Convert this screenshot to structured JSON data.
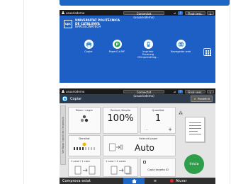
{
  "home": {
    "status_bar": {
      "user": "usuarioderno",
      "connection": "Connectat (usuariodemo)",
      "help": "?",
      "finish_session": "Final sess.",
      "lang": "L"
    },
    "logo_mark": "upc",
    "university_line1": "UNIVERSITAT POLITÈCNICA",
    "university_line2": "DE CATALUNYA",
    "university_line3": "BARCELONATECH",
    "apps": [
      {
        "label": "Copiar",
        "icon": "copier-icon",
        "color": "#2f8fd8"
      },
      {
        "label": "PaperCut MF",
        "icon": "papercut-icon",
        "color": "#1aa64a"
      },
      {
        "label": "Imprimir\nEscaneig D'Impremtimg...",
        "icon": "print-release-icon",
        "color": "#2f8fd8"
      },
      {
        "label": "Navegador web",
        "icon": "globe-icon",
        "color": "#2f8fd8"
      }
    ]
  },
  "copy": {
    "status_bar": {
      "user": "usuarioderno",
      "connection": "Connectat (usuariodemo)",
      "help": "?",
      "finish_session": "Final sess.",
      "lang": "L"
    },
    "title": "Copiar",
    "presets": "Predefinit",
    "side_tab": "Verifique l'opció de l'impressió",
    "color_mode": {
      "label": "Blanc i negre"
    },
    "reduce_enlarge": {
      "label": "Reduce /Amplia",
      "value": "100%"
    },
    "quantity": {
      "label": "Quantitat",
      "value": "1"
    },
    "density": {
      "label": "Densitat"
    },
    "paper_select": {
      "label": "Selecció paper",
      "value": "Auto"
    },
    "duplex": {
      "label": "1 cara→ 1 cara"
    },
    "combine": {
      "label": "1 cara→ 2 cares"
    },
    "id_card": {
      "label": "Copia targeta ID"
    },
    "start": "Inicia",
    "bottom": {
      "status": "Comprova estat",
      "stop": "Aturar"
    }
  }
}
